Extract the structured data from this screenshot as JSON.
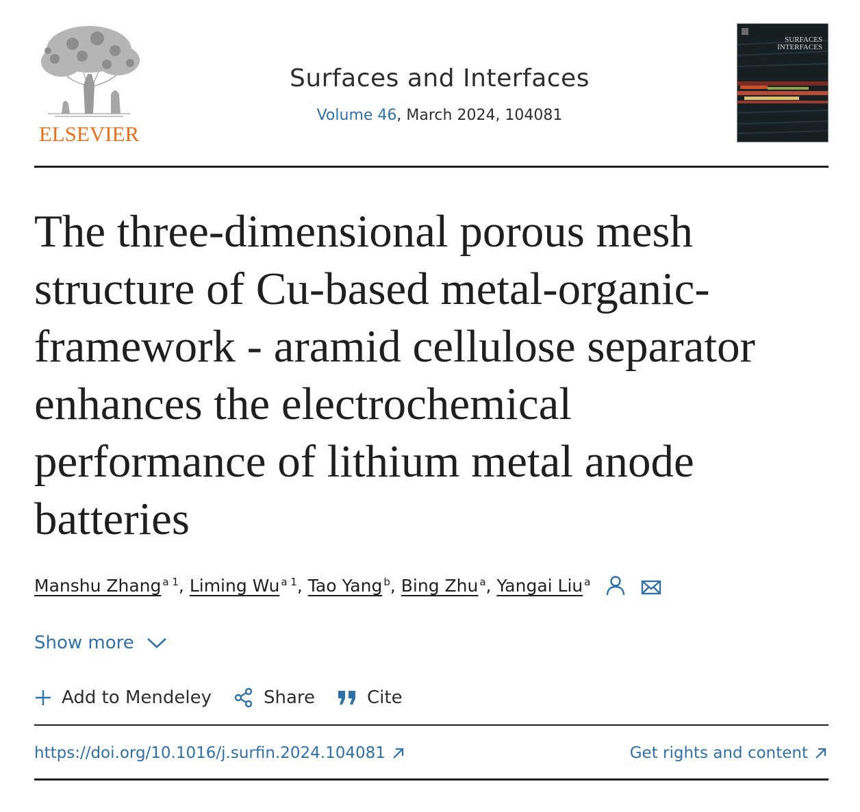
{
  "header": {
    "publisher_logo_text": "ELSEVIER",
    "journal_name": "Surfaces and Interfaces",
    "volume_link": "Volume 46",
    "issue_info": ", March 2024, 104081",
    "cover_title": "SURFACES INTERFACES"
  },
  "article": {
    "title_lines": [
      "The three-dimensional porous mesh",
      "structure of Cu-based metal-organic-",
      "framework - aramid cellulose separator",
      "enhances the electrochemical",
      "performance of lithium metal anode",
      "batteries"
    ],
    "authors": [
      {
        "name": "Manshu Zhang",
        "aff": "a 1",
        "sep": ", "
      },
      {
        "name": "Liming Wu",
        "aff": "a 1",
        "sep": ", "
      },
      {
        "name": "Tao Yang",
        "aff": "b",
        "sep": ", "
      },
      {
        "name": "Bing Zhu",
        "aff": "a",
        "sep": ", "
      },
      {
        "name": "Yangai Liu",
        "aff": "a",
        "sep": ""
      }
    ],
    "show_more_label": "Show more"
  },
  "actions": {
    "add_label": "Add to Mendeley",
    "share_label": "Share",
    "cite_label": "Cite"
  },
  "links": {
    "doi": "https://doi.org/10.1016/j.surfin.2024.104081",
    "rights": "Get rights and content"
  },
  "colors": {
    "link": "#2e70a8",
    "elsevier_orange": "#e9711c",
    "text": "#1f1f1f"
  }
}
